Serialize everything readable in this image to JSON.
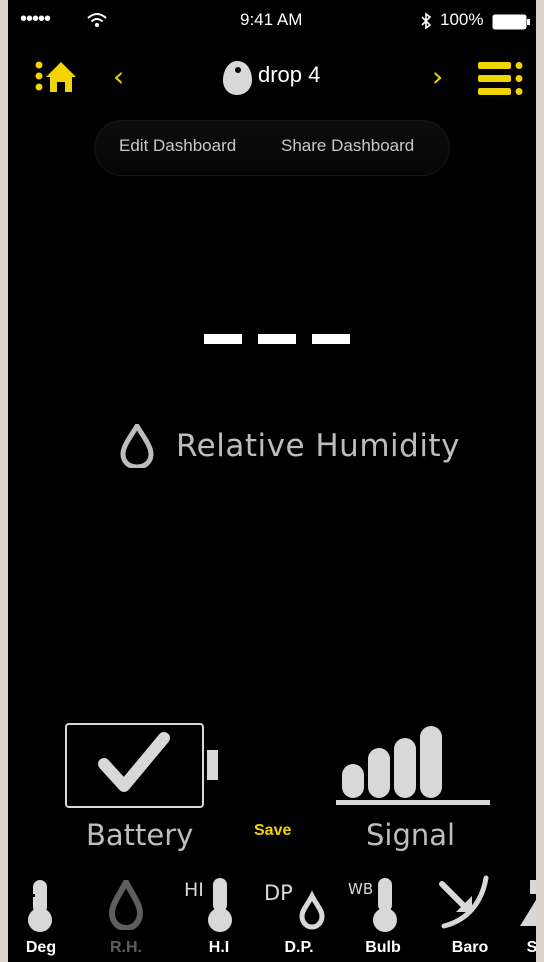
{
  "status_bar": {
    "carrier": "•••••",
    "time": "9:41 AM",
    "battery": "100%"
  },
  "nav": {
    "title": "drop 4",
    "prev": "‹",
    "next": "›"
  },
  "dashboard": {
    "edit_label": "Edit Dashboard",
    "share_label": "Share Dashboard"
  },
  "reading": {
    "value": "---",
    "label": "Relative Humidity"
  },
  "indicators": {
    "battery_label": "Battery",
    "save_label": "Save",
    "signal_label": "Signal"
  },
  "tabs": [
    {
      "label": "Deg",
      "icon": "thermometer-icon",
      "active": true
    },
    {
      "label": "R.H.",
      "icon": "drop-icon",
      "active": false
    },
    {
      "label": "H.I",
      "icon": "heat-index-icon",
      "active": true
    },
    {
      "label": "D.P.",
      "icon": "dew-point-icon",
      "active": true
    },
    {
      "label": "Bulb",
      "icon": "wet-bulb-icon",
      "active": true
    },
    {
      "label": "Baro",
      "icon": "barometer-icon",
      "active": true
    },
    {
      "label": "S",
      "icon": "partial-icon",
      "active": true
    }
  ],
  "colors": {
    "accent": "#f1d400",
    "background": "#000000",
    "text_dim": "#bdbdbd"
  }
}
